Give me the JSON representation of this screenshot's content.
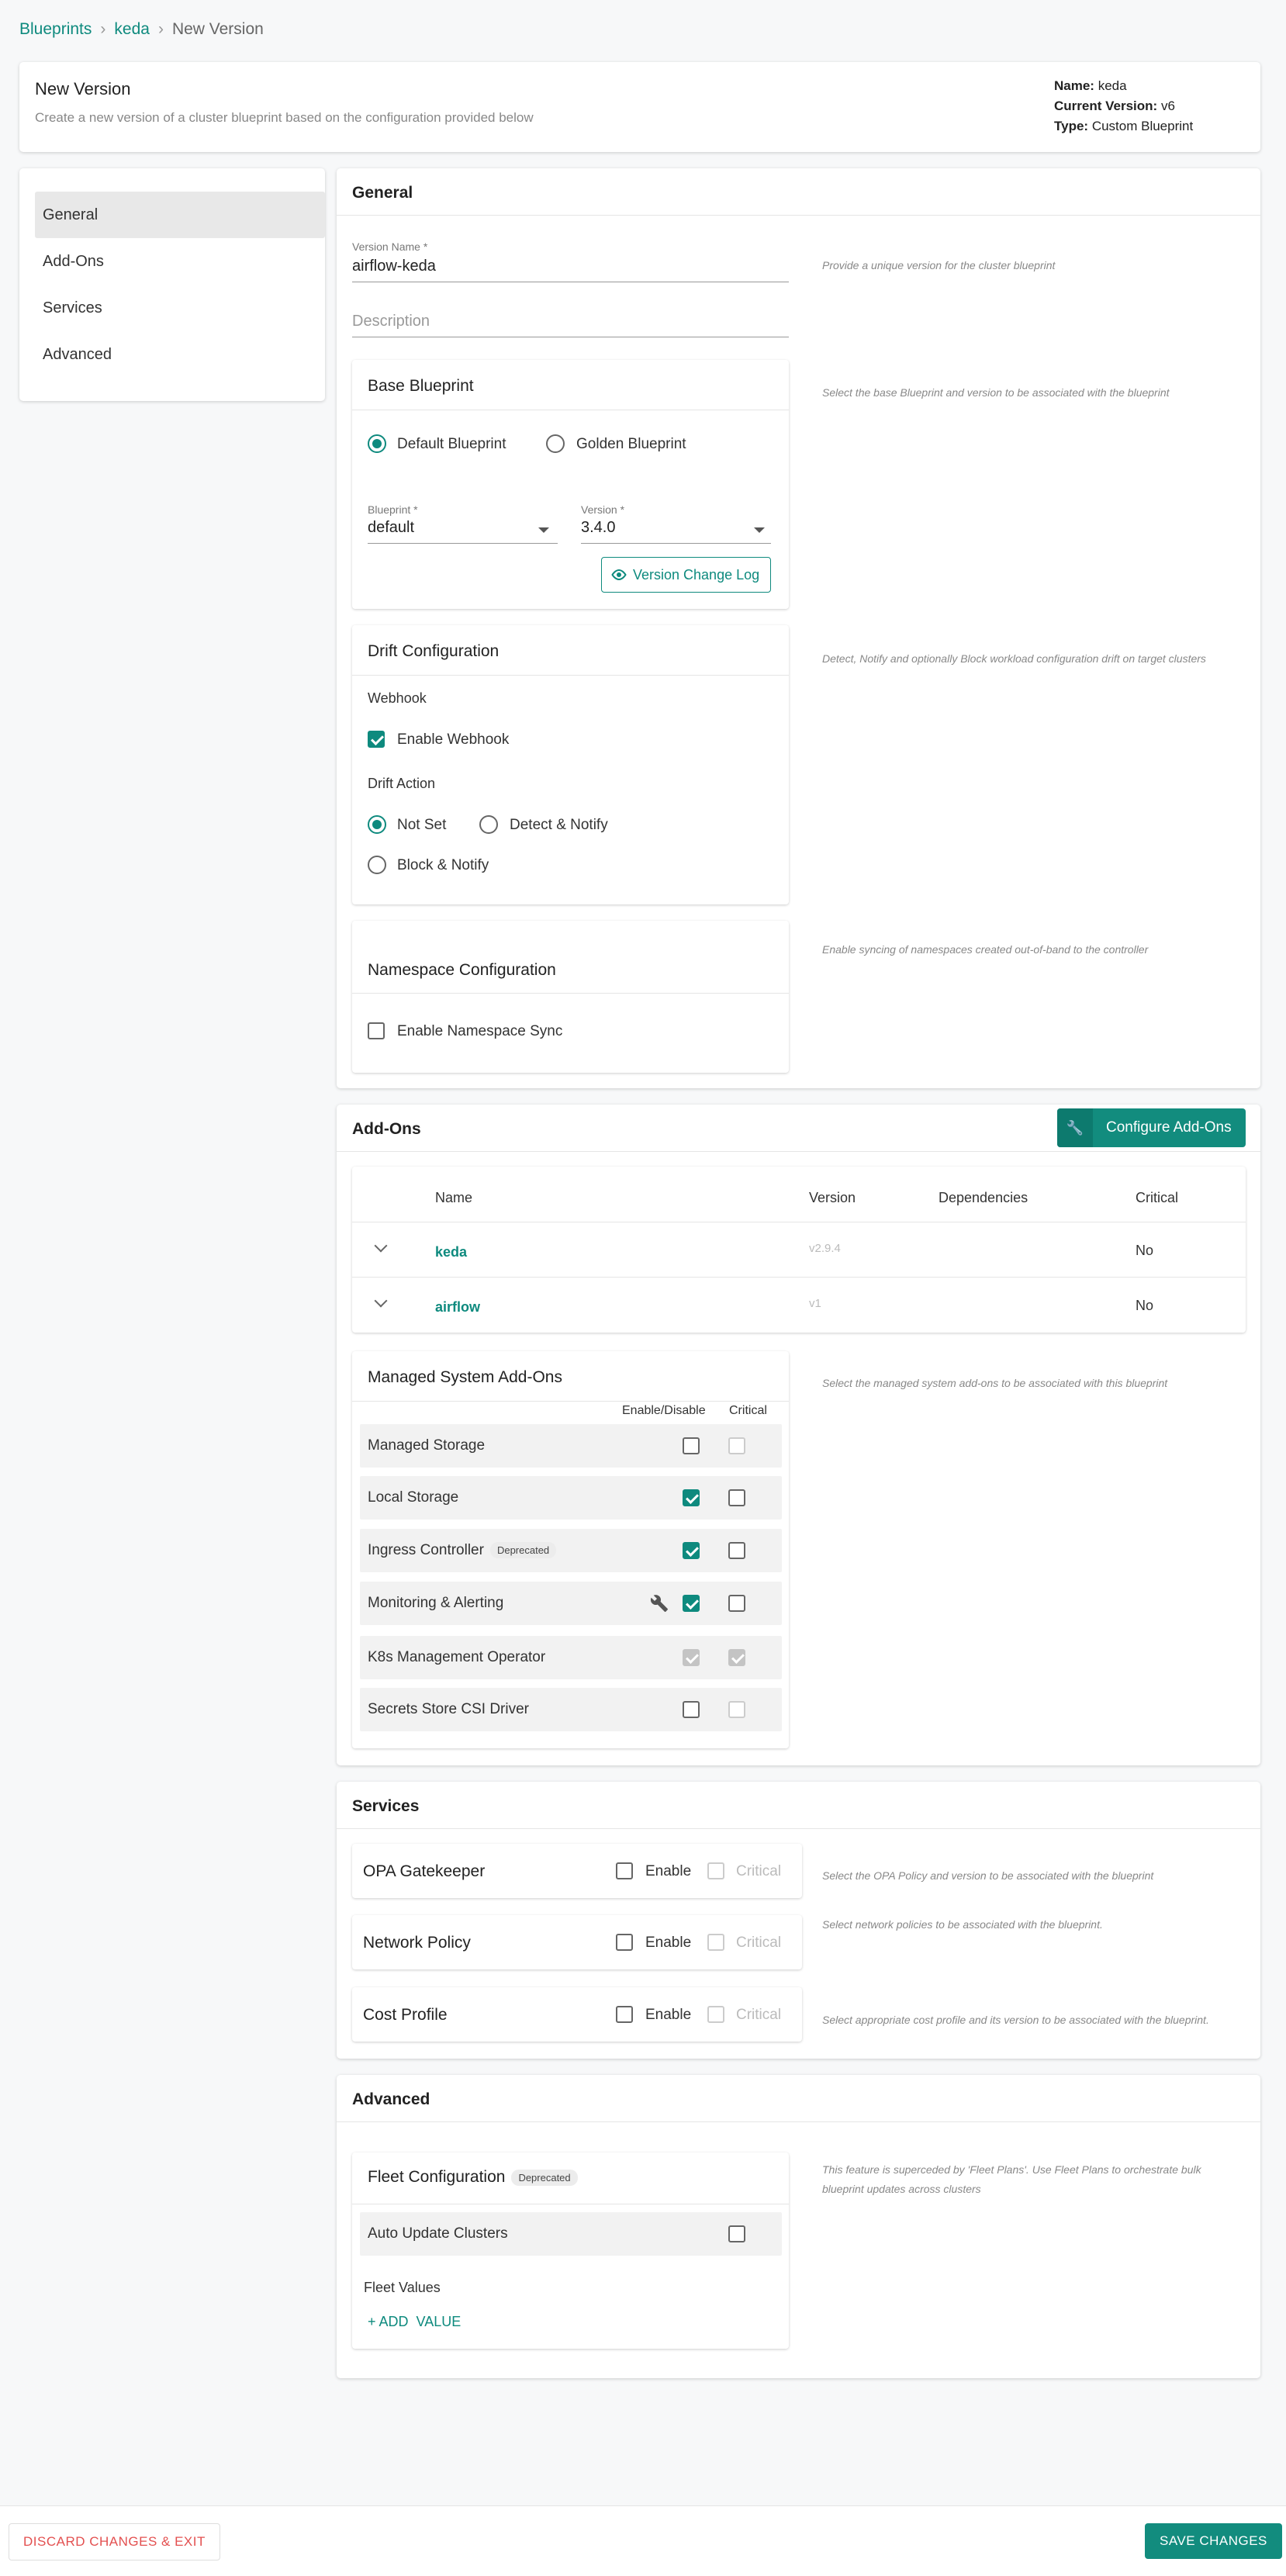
{
  "breadcrumb": {
    "items": [
      "Blueprints",
      "keda",
      "New Version"
    ]
  },
  "header": {
    "title": "New Version",
    "subtitle": "Create a new version of a cluster blueprint based on the configuration provided below",
    "name_label": "Name:",
    "name_value": "keda",
    "current_version_label": "Current Version:",
    "current_version_value": "v6",
    "type_label": "Type:",
    "type_value": "Custom Blueprint"
  },
  "nav": {
    "items": [
      "General",
      "Add-Ons",
      "Services",
      "Advanced"
    ],
    "active": "General"
  },
  "general": {
    "title": "General",
    "version_name_label": "Version Name *",
    "version_name_value": "airflow-keda",
    "version_hint": "Provide a unique version for the cluster blueprint",
    "description_placeholder": "Description",
    "base_blueprint": {
      "title": "Base Blueprint",
      "hint": "Select the base Blueprint and version to be associated with the blueprint",
      "radio_default": "Default Blueprint",
      "radio_golden": "Golden Blueprint",
      "selected": "Default Blueprint",
      "blueprint_label": "Blueprint *",
      "blueprint_value": "default",
      "version_label": "Version *",
      "version_value": "3.4.0",
      "changelog_button": "Version Change Log"
    },
    "drift": {
      "title": "Drift Configuration",
      "hint": "Detect, Notify and optionally Block workload configuration drift on target clusters",
      "webhook_label": "Webhook",
      "enable_webhook": "Enable Webhook",
      "enable_webhook_checked": true,
      "action_label": "Drift Action",
      "options": [
        "Not Set",
        "Detect & Notify",
        "Block & Notify"
      ],
      "selected": "Not Set"
    },
    "namespace": {
      "title": "Namespace Configuration",
      "hint": "Enable syncing of namespaces created out-of-band to the controller",
      "enable_sync": "Enable Namespace Sync",
      "enable_sync_checked": false
    }
  },
  "addons": {
    "title": "Add-Ons",
    "configure_button": "Configure Add-Ons",
    "columns": [
      "Name",
      "Version",
      "Dependencies",
      "Critical"
    ],
    "rows": [
      {
        "name": "keda",
        "version": "v2.9.4",
        "dependencies": "",
        "critical": "No"
      },
      {
        "name": "airflow",
        "version": "v1",
        "dependencies": "",
        "critical": "No"
      }
    ],
    "managed": {
      "title": "Managed System Add-Ons",
      "hint": "Select the managed system add-ons to be associated with this blueprint",
      "col_enable": "Enable/Disable",
      "col_critical": "Critical",
      "items": [
        {
          "name": "Managed Storage",
          "badge": "",
          "enabled": false,
          "critical": false,
          "critical_disabled": true,
          "locked": false,
          "wrench": false
        },
        {
          "name": "Local Storage",
          "badge": "",
          "enabled": true,
          "critical": false,
          "critical_disabled": false,
          "locked": false,
          "wrench": false
        },
        {
          "name": "Ingress Controller",
          "badge": "Deprecated",
          "enabled": true,
          "critical": false,
          "critical_disabled": false,
          "locked": false,
          "wrench": false
        },
        {
          "name": "Monitoring & Alerting",
          "badge": "",
          "enabled": true,
          "critical": false,
          "critical_disabled": false,
          "locked": false,
          "wrench": true
        },
        {
          "name": "K8s Management Operator",
          "badge": "",
          "enabled": true,
          "critical": true,
          "critical_disabled": true,
          "locked": true,
          "wrench": false
        },
        {
          "name": "Secrets Store CSI Driver",
          "badge": "",
          "enabled": false,
          "critical": false,
          "critical_disabled": true,
          "locked": false,
          "wrench": false
        }
      ]
    }
  },
  "services": {
    "title": "Services",
    "enable_label": "Enable",
    "critical_label": "Critical",
    "items": [
      {
        "name": "OPA Gatekeeper",
        "hint": "Select the OPA Policy and version to be associated with the blueprint"
      },
      {
        "name": "Network Policy",
        "hint": "Select network policies to be associated with the blueprint."
      },
      {
        "name": "Cost Profile",
        "hint": "Select appropriate cost profile and its version to be associated with the blueprint."
      }
    ]
  },
  "advanced": {
    "title": "Advanced",
    "fleet_title": "Fleet Configuration",
    "fleet_badge": "Deprecated",
    "fleet_hint": "This feature is superceded by 'Fleet Plans'. Use Fleet Plans to orchestrate bulk blueprint updates across clusters",
    "auto_update": "Auto Update Clusters",
    "fleet_values": "Fleet Values",
    "add_value": "+ ADD  VALUE"
  },
  "footer": {
    "discard": "DISCARD CHANGES & EXIT",
    "save": "SAVE CHANGES"
  },
  "colors": {
    "accent": "#128c7e",
    "danger": "#e35050"
  }
}
